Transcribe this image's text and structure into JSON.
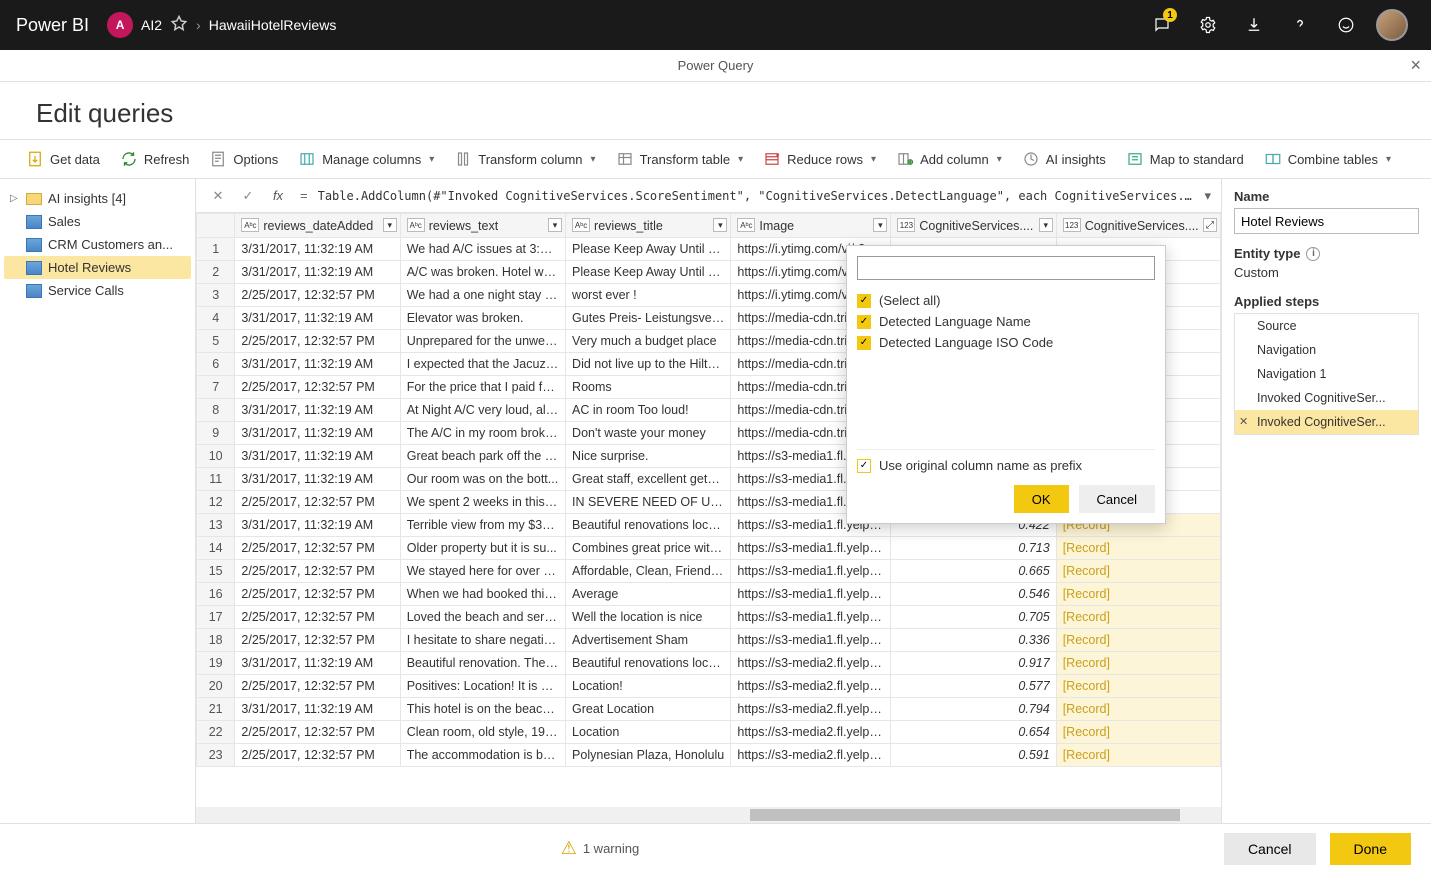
{
  "topbar": {
    "logo": "Power BI",
    "avatar_initial": "A",
    "workspace": "AI2",
    "breadcrumb": "HawaiiHotelReviews",
    "notification_count": "1"
  },
  "pq_header": {
    "title": "Power Query"
  },
  "page_title": "Edit queries",
  "ribbon": {
    "get_data": "Get data",
    "refresh": "Refresh",
    "options": "Options",
    "manage_columns": "Manage columns",
    "transform_column": "Transform column",
    "transform_table": "Transform table",
    "reduce_rows": "Reduce rows",
    "add_column": "Add column",
    "ai_insights": "AI insights",
    "map_to_standard": "Map to standard",
    "combine_tables": "Combine tables"
  },
  "left_pane": {
    "folder": "AI insights  [4]",
    "items": [
      "Sales",
      "CRM Customers an...",
      "Hotel Reviews",
      "Service Calls"
    ],
    "selected": "Hotel Reviews"
  },
  "formula": "Table.AddColumn(#\"Invoked CognitiveServices.ScoreSentiment\", \"CognitiveServices.DetectLanguage\", each CognitiveServices.DetectLangua…",
  "columns": [
    {
      "name": "reviews_dateAdded",
      "type": "date"
    },
    {
      "name": "reviews_text",
      "type": "text"
    },
    {
      "name": "reviews_title",
      "type": "text"
    },
    {
      "name": "Image",
      "type": "text"
    },
    {
      "name": "CognitiveServices....",
      "type": "num"
    },
    {
      "name": "CognitiveServices....",
      "type": "rec"
    }
  ],
  "rows": [
    [
      "3/31/2017, 11:32:19 AM",
      "We had A/C issues at 3:30 ...",
      "Please Keep Away Until Co...",
      "https://i.ytimg.com/vi/-3s",
      "",
      ""
    ],
    [
      "3/31/2017, 11:32:19 AM",
      "A/C was broken. Hotel was...",
      "Please Keep Away Until Co...",
      "https://i.ytimg.com/vi/gV",
      "",
      ""
    ],
    [
      "2/25/2017, 12:32:57 PM",
      "We had a one night stay at...",
      "worst ever !",
      "https://i.ytimg.com/vi/xcE",
      "",
      ""
    ],
    [
      "3/31/2017, 11:32:19 AM",
      "Elevator was broken.",
      "Gutes Preis- Leistungsverh...",
      "https://media-cdn.tripadv",
      "",
      ""
    ],
    [
      "2/25/2017, 12:32:57 PM",
      "Unprepared for the unwelc...",
      "Very much a budget place",
      "https://media-cdn.tripadv",
      "",
      ""
    ],
    [
      "3/31/2017, 11:32:19 AM",
      "I expected that the Jacuzzi ...",
      "Did not live up to the Hilto...",
      "https://media-cdn.tripadv",
      "",
      ""
    ],
    [
      "2/25/2017, 12:32:57 PM",
      "For the price that I paid for...",
      "Rooms",
      "https://media-cdn.tripadv",
      "",
      ""
    ],
    [
      "3/31/2017, 11:32:19 AM",
      "At Night A/C very loud, als...",
      "AC in room Too loud!",
      "https://media-cdn.tripadv",
      "",
      ""
    ],
    [
      "3/31/2017, 11:32:19 AM",
      "The A/C in my room broke...",
      "Don't waste your money",
      "https://media-cdn.tripadv",
      "",
      ""
    ],
    [
      "3/31/2017, 11:32:19 AM",
      "Great beach park off the la...",
      "Nice surprise.",
      "https://s3-media1.fl.yelpc",
      "",
      ""
    ],
    [
      "3/31/2017, 11:32:19 AM",
      "Our room was on the bott...",
      "Great staff, excellent getaw...",
      "https://s3-media1.fl.yelpc",
      "",
      ""
    ],
    [
      "2/25/2017, 12:32:57 PM",
      "We spent 2 weeks in this h...",
      "IN SEVERE NEED OF UPDA...",
      "https://s3-media1.fl.yelpc",
      "",
      ""
    ],
    [
      "3/31/2017, 11:32:19 AM",
      "Terrible view from my $300...",
      "Beautiful renovations locat...",
      "https://s3-media1.fl.yelpcd...",
      "0.422",
      "[Record]"
    ],
    [
      "2/25/2017, 12:32:57 PM",
      "Older property but it is su...",
      "Combines great price with ...",
      "https://s3-media1.fl.yelpcd...",
      "0.713",
      "[Record]"
    ],
    [
      "2/25/2017, 12:32:57 PM",
      "We stayed here for over a ...",
      "Affordable, Clean, Friendly ...",
      "https://s3-media1.fl.yelpcd...",
      "0.665",
      "[Record]"
    ],
    [
      "2/25/2017, 12:32:57 PM",
      "When we had booked this ...",
      "Average",
      "https://s3-media1.fl.yelpcd...",
      "0.546",
      "[Record]"
    ],
    [
      "2/25/2017, 12:32:57 PM",
      "Loved the beach and service",
      "Well the location is nice",
      "https://s3-media1.fl.yelpcd...",
      "0.705",
      "[Record]"
    ],
    [
      "2/25/2017, 12:32:57 PM",
      "I hesitate to share negative...",
      "Advertisement Sham",
      "https://s3-media1.fl.yelpcd...",
      "0.336",
      "[Record]"
    ],
    [
      "3/31/2017, 11:32:19 AM",
      "Beautiful renovation. The h...",
      "Beautiful renovations locat...",
      "https://s3-media2.fl.yelpcd...",
      "0.917",
      "[Record]"
    ],
    [
      "2/25/2017, 12:32:57 PM",
      "Positives: Location! It is on ...",
      "Location!",
      "https://s3-media2.fl.yelpcd...",
      "0.577",
      "[Record]"
    ],
    [
      "3/31/2017, 11:32:19 AM",
      "This hotel is on the beach ...",
      "Great Location",
      "https://s3-media2.fl.yelpcd...",
      "0.794",
      "[Record]"
    ],
    [
      "2/25/2017, 12:32:57 PM",
      "Clean room, old style, 196...",
      "Location",
      "https://s3-media2.fl.yelpcd...",
      "0.654",
      "[Record]"
    ],
    [
      "2/25/2017, 12:32:57 PM",
      "The accommodation is bas...",
      "Polynesian Plaza, Honolulu",
      "https://s3-media2.fl.yelpcd...",
      "0.591",
      "[Record]"
    ]
  ],
  "expand_popup": {
    "search_placeholder": "",
    "select_all": "(Select all)",
    "opt1": "Detected Language Name",
    "opt2": "Detected Language ISO Code",
    "prefix": "Use original column name as prefix",
    "ok": "OK",
    "cancel": "Cancel"
  },
  "right_pane": {
    "name_label": "Name",
    "name_value": "Hotel Reviews",
    "entity_label": "Entity type",
    "entity_value": "Custom",
    "steps_label": "Applied steps",
    "steps": [
      "Source",
      "Navigation",
      "Navigation 1",
      "Invoked CognitiveSer...",
      "Invoked CognitiveSer..."
    ],
    "selected_step": 4
  },
  "footer": {
    "warning": "1 warning",
    "cancel": "Cancel",
    "done": "Done"
  }
}
